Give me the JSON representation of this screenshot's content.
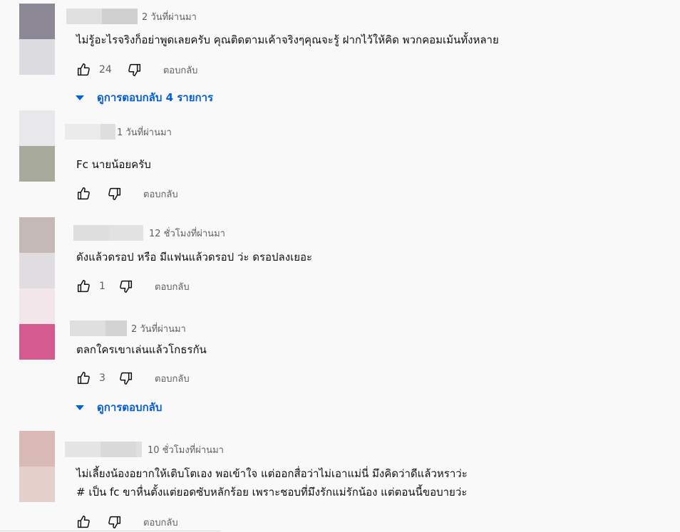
{
  "comments": [
    {
      "time": "2 วันที่ผ่านมา",
      "text": "ไม่รู้อะไรจริงก็อย่าพูดเลยครับ คุณติดตามเค้าจริงๆคุณจะรู้ ฝากไว้ให้คิด พวกคอมเม้นทั้งหลาย",
      "likes": "24",
      "reply_label": "ตอบกลับ",
      "replies_label": "ดูการตอบกลับ 4 รายการ",
      "avatar_colors": [
        "#8c8896",
        "#dcdbe0"
      ],
      "name_colors": [
        "#e0e0e0",
        "#d0d0d0",
        "#dcdcdc"
      ]
    },
    {
      "time": "1 วันที่ผ่านมา",
      "text": "Fc นายน้อยครับ",
      "likes": "",
      "reply_label": "ตอบกลับ",
      "avatar_colors": [
        "#e8e8eb",
        "#a8ab9c"
      ],
      "name_colors": [
        "#ebebeb",
        "#dedede"
      ]
    },
    {
      "time": "12 ชั่วโมงที่ผ่านมา",
      "text": "ดังแล้วดรอป หรือ มีแฟนแล้วดรอป ว่ะ ดรอปลงเยอะ",
      "likes": "1",
      "reply_label": "ตอบกลับ",
      "avatar_colors": [
        "#c4b9b7",
        "#e1dce0",
        "#f2e6eb"
      ],
      "name_colors": [
        "#dedede",
        "#e2e2e2"
      ]
    },
    {
      "time": "2 วันที่ผ่านมา",
      "text": "ตลกใครเขาเล่นแล้วโกธรกัน",
      "likes": "3",
      "reply_label": "ตอบกลับ",
      "replies_label": "ดูการตอบกลับ",
      "avatar_colors": [
        "#d55a8f"
      ],
      "name_colors": [
        "#e0dfe0",
        "#d3d3d3"
      ]
    },
    {
      "time": "10 ชั่วโมงที่ผ่านมา",
      "text_lines": [
        "ไม่เลี้ยงน้องอยากให้เติบโตเอง พอเข้าใจ แต่ออกสื่อว่าไม่เอาแม่นี่ มึงคิดว่าดีแล้วหราว่ะ",
        "# เป็น fc ขาหื่นตั้งแต่ยอดซับหลักร้อย เพราะชอบที่มึงรักแม่รักน้อง แต่ตอนนี้ขอบายว่ะ"
      ],
      "likes": "",
      "reply_label": "ตอบกลับ",
      "avatar_colors": [
        "#d9bab4",
        "#e4cfca"
      ],
      "name_colors": [
        "#e5e5e5",
        "#dadada",
        "#e0e0e0"
      ]
    }
  ],
  "icons": {
    "like": "thumb-up-icon",
    "dislike": "thumb-down-icon",
    "expand": "triangle-down-icon"
  },
  "colors": {
    "link_blue": "#065fd4",
    "meta_gray": "#606060"
  }
}
